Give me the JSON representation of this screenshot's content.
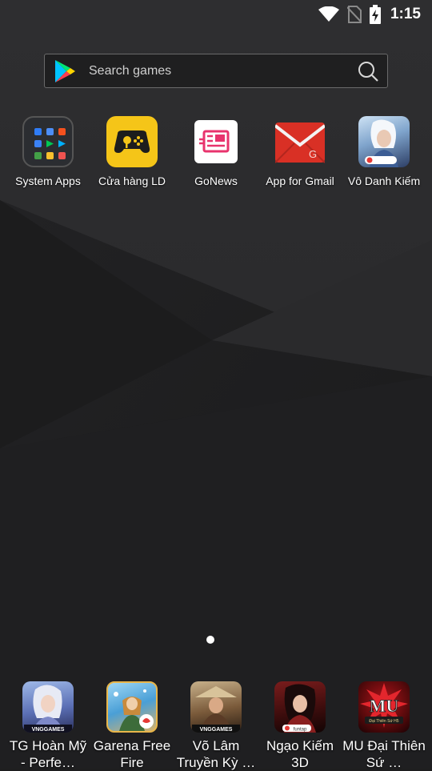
{
  "status_bar": {
    "time": "1:15",
    "icons": [
      "wifi-icon",
      "no-sim-icon",
      "battery-charging-icon"
    ]
  },
  "search": {
    "placeholder": "Search games",
    "icon_left": "play-store-icon",
    "icon_right": "search-icon"
  },
  "home_apps": [
    {
      "label": "System Apps",
      "icon": "folder-icon"
    },
    {
      "label": "Cửa hàng LD",
      "icon": "gamepad-store-icon"
    },
    {
      "label": "GoNews",
      "icon": "news-icon"
    },
    {
      "label": "App for Gmail",
      "icon": "gmail-icon"
    },
    {
      "label": "Vô Danh Kiếm",
      "icon": "game-portrait-icon",
      "badge": "funtap"
    }
  ],
  "dock_apps": [
    {
      "label": "TG Hoàn Mỹ - Perfe…",
      "icon": "game-portrait-icon",
      "badge": "VNGGAMES"
    },
    {
      "label": "Garena Free Fire",
      "icon": "game-portrait-icon"
    },
    {
      "label": "Võ Lâm Truyền Kỳ …",
      "icon": "game-portrait-icon",
      "badge": "VNGGAMES"
    },
    {
      "label": "Ngạo Kiếm 3D",
      "icon": "game-portrait-icon",
      "badge": "funtap"
    },
    {
      "label": "MU Đại Thiên Sứ …",
      "icon": "game-logo-icon",
      "badge": "Đại Thiên Sứ H5"
    }
  ],
  "colors": {
    "background": "#1e1e1f",
    "store_yellow": "#f5c518",
    "gmail_red": "#d93025",
    "gonews_pink": "#e8336d"
  }
}
